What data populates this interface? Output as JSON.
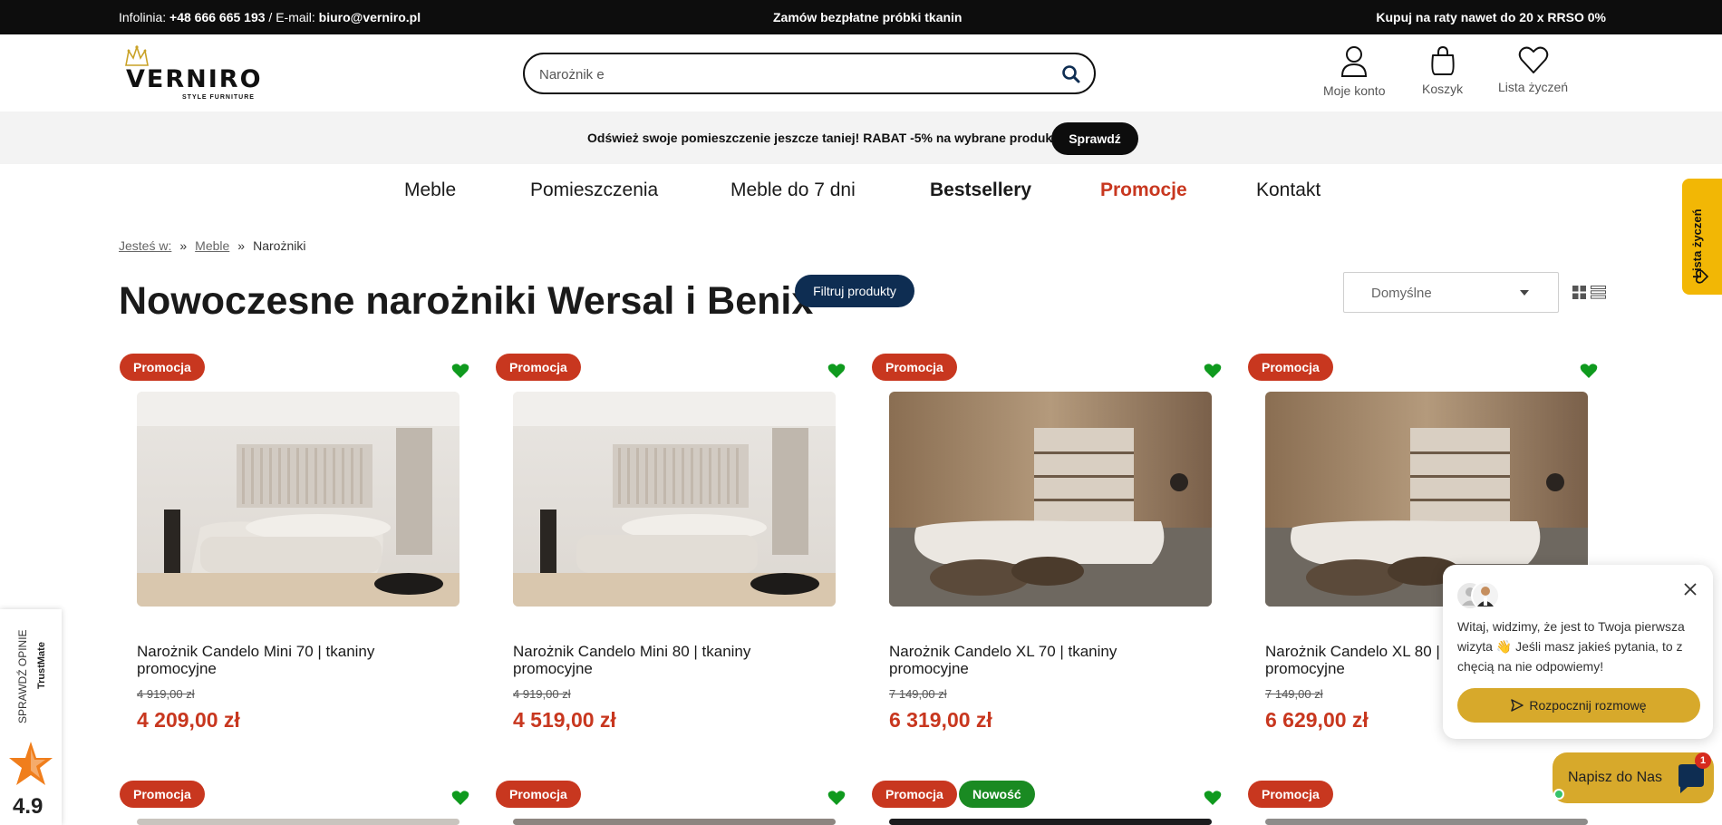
{
  "topbar": {
    "phone_label": "Infolinia: ",
    "phone": "+48 666 665 193",
    "email_label": " / E-mail: ",
    "email": "biuro@verniro.pl",
    "center": "Zamów bezpłatne próbki tkanin",
    "right": "Kupuj na raty nawet do 20 x RRSO 0%"
  },
  "header": {
    "logo_text": "VERNIRO",
    "logo_tagline": "STYLE FURNITURE",
    "search_value": "Narożnik e",
    "icons": [
      {
        "label": "Moje konto",
        "icon": "user-icon"
      },
      {
        "label": "Koszyk",
        "icon": "bag-icon"
      },
      {
        "label": "Lista życzeń",
        "icon": "heart-icon"
      }
    ]
  },
  "promo": {
    "text": "Odśwież swoje pomieszczenie jeszcze taniej! RABAT -5% na wybrane produkty",
    "button": "Sprawdź"
  },
  "nav": {
    "items": [
      "Meble",
      "Pomieszczenia",
      "Meble do 7 dni",
      "Bestsellery",
      "Promocje",
      "Kontakt"
    ]
  },
  "sidetab": {
    "label": "Lista życzeń"
  },
  "breadcrumb": {
    "prefix": "Jesteś w:",
    "sep": "»",
    "items": [
      "Meble"
    ],
    "current": "Narożniki"
  },
  "page": {
    "title": "Nowoczesne narożniki Wersal i Benix",
    "filter_button": "Filtruj produkty",
    "sort_value": "Domyślne"
  },
  "products": [
    {
      "badges": [
        "Promocja"
      ],
      "name": "Narożnik Candelo Mini 70 | tkaniny promocyjne",
      "old_price": "4 919,00 zł",
      "price": "4 209,00 zł"
    },
    {
      "badges": [
        "Promocja"
      ],
      "name": "Narożnik Candelo Mini 80 | tkaniny promocyjne",
      "old_price": "4 919,00 zł",
      "price": "4 519,00 zł"
    },
    {
      "badges": [
        "Promocja"
      ],
      "name": "Narożnik Candelo XL 70 | tkaniny promocyjne",
      "old_price": "7 149,00 zł",
      "price": "6 319,00 zł"
    },
    {
      "badges": [
        "Promocja"
      ],
      "name": "Narożnik Candelo XL 80 | tkaniny promocyjne",
      "old_price": "7 149,00 zł",
      "price": "6 629,00 zł"
    },
    {
      "badges": [
        "Promocja"
      ]
    },
    {
      "badges": [
        "Promocja"
      ]
    },
    {
      "badges": [
        "Promocja",
        "Nowość"
      ]
    },
    {
      "badges": [
        "Promocja"
      ]
    }
  ],
  "trustmate": {
    "label": "SPRAWDŹ OPINIE",
    "brand": "TrustMate",
    "rating": "4.9"
  },
  "chat": {
    "message": "Witaj, widzimy, że jest to Twoja pierwsza wizyta 👋 Jeśli masz jakieś pytania, to z chęcią na nie odpowiemy!",
    "button": "Rozpocznij rozmowę",
    "widget_label": "Napisz do Nas",
    "unread": "1"
  },
  "colors": {
    "promo_red": "#c8371f",
    "new_green": "#1a8a22",
    "navy": "#0e2d52",
    "gold": "#d7a92b",
    "wishlist_yellow": "#f2b705"
  }
}
